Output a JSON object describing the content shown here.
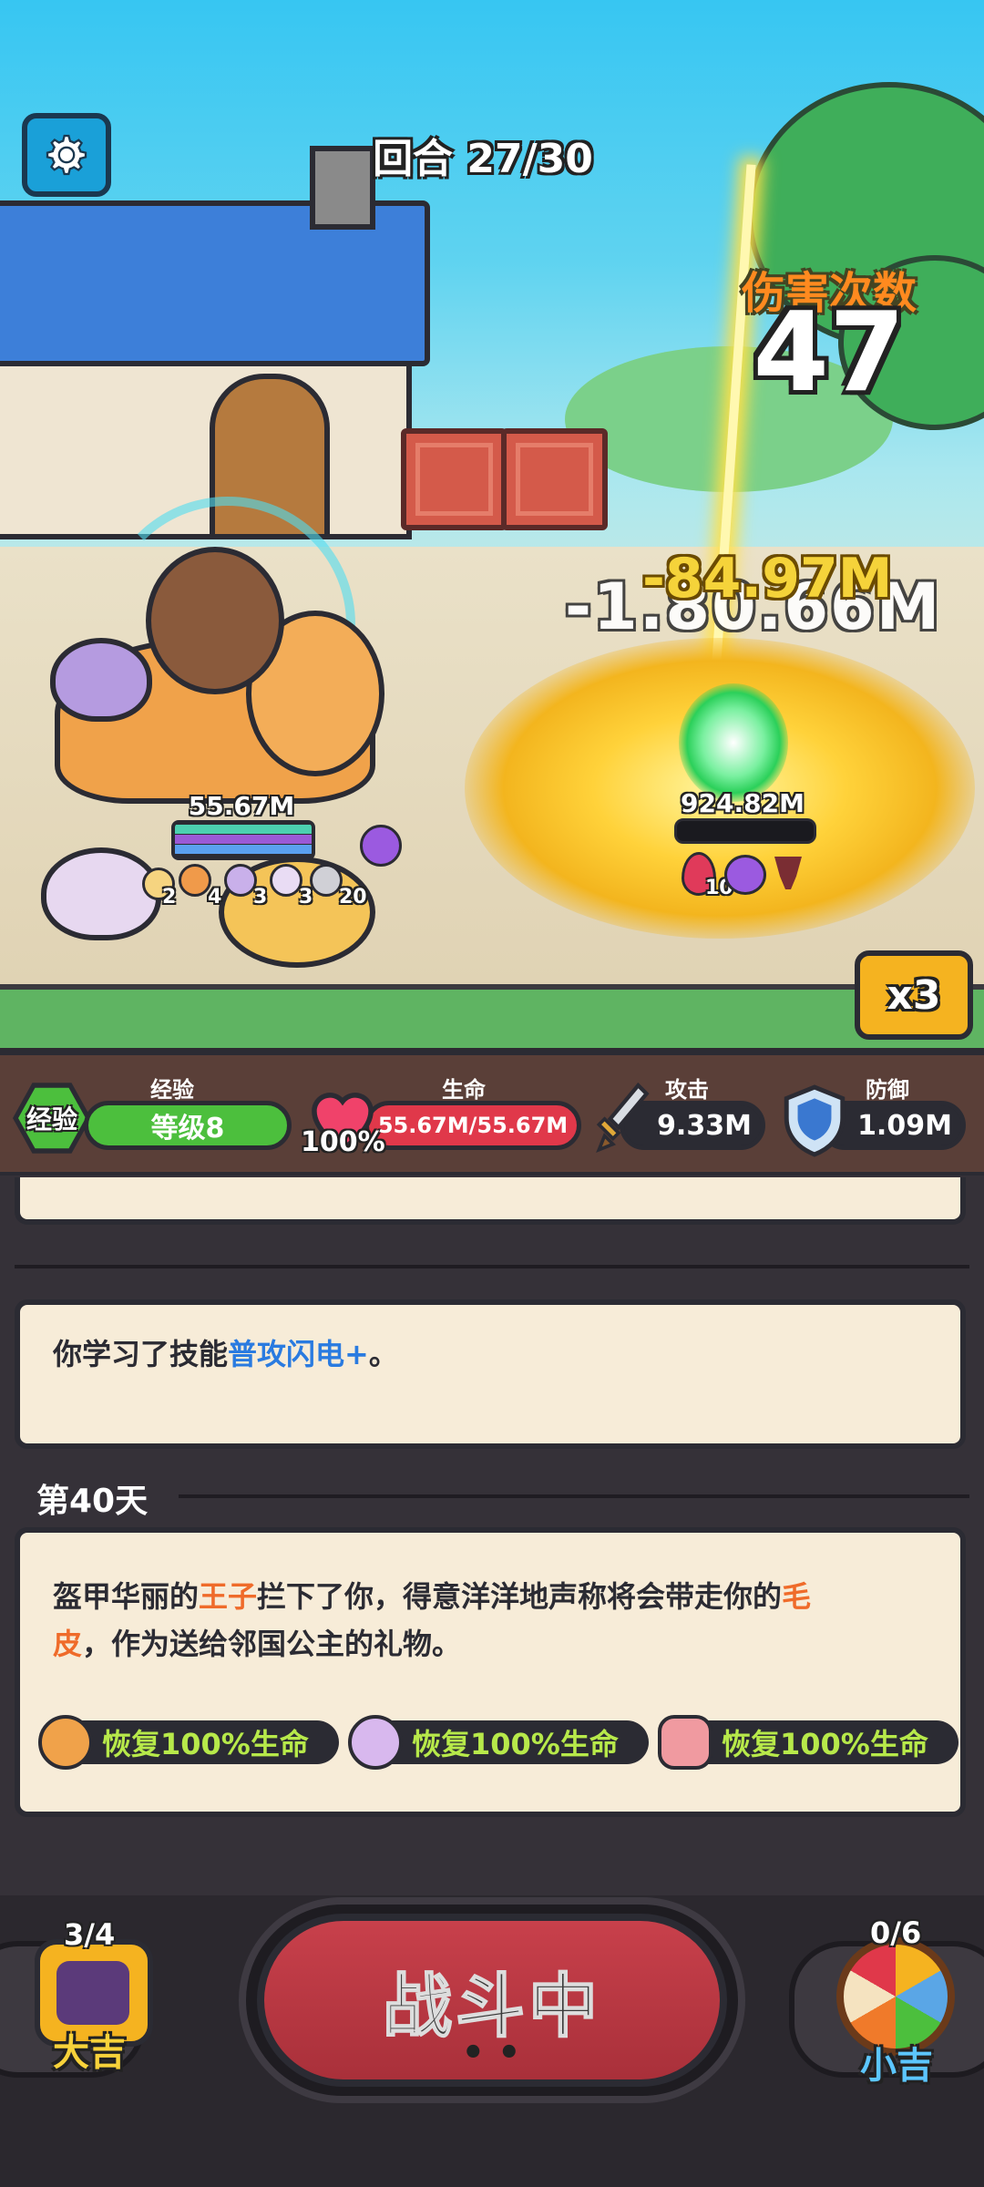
{
  "hud": {
    "round_text": "回合 27/30",
    "damage_count_label": "伤害次数",
    "damage_count": "47",
    "float_damage_1": "-1.80.66M",
    "float_damage_2": "-84.97M",
    "speed_label": "x3"
  },
  "player": {
    "hp_text": "55.67M",
    "buff_counts": [
      "2",
      "4",
      "3",
      "3",
      "20"
    ]
  },
  "enemy": {
    "hp_text": "924.82M",
    "debuff_count": "10"
  },
  "stats": {
    "exp_badge": "经验",
    "exp_label": "经验",
    "level_text": "等级8",
    "hp_label": "生命",
    "hp_percent": "100%",
    "hp_value": "55.67M/55.67M",
    "attack_label": "攻击",
    "attack_value": "9.33M",
    "defense_label": "防御",
    "defense_value": "1.09M"
  },
  "log": {
    "skill_prefix": "你学习了技能",
    "skill_name": "普攻闪电+",
    "skill_suffix": "。",
    "day_title": "第40天",
    "event_part1": "盔甲华丽的",
    "event_prince": "王子",
    "event_part2": "拦下了你，得意洋洋地声称将会带走你的",
    "event_fur1": "毛",
    "event_fur2": "皮",
    "event_part3": "，作为送给邻国公主的礼物。",
    "rewards": [
      {
        "text": "恢复100%生命",
        "icon": "tiger-pet-icon"
      },
      {
        "text": "恢复100%生命",
        "icon": "unicorn-blob-icon"
      },
      {
        "text": "恢复100%生命",
        "icon": "pig-pet-icon"
      }
    ]
  },
  "bottom": {
    "left_count": "3/4",
    "left_label": "大吉",
    "fight_label": "战斗中",
    "fight_dots": "• •",
    "right_count": "0/6",
    "right_label": "小吉"
  },
  "colors": {
    "exp_green": "#4cbf3d",
    "hp_red": "#e0384a",
    "fight_red": "#c8404b",
    "highlight_blue": "#2a7be0",
    "highlight_orange": "#ef6b2a",
    "reward_green": "#b7e94a"
  }
}
